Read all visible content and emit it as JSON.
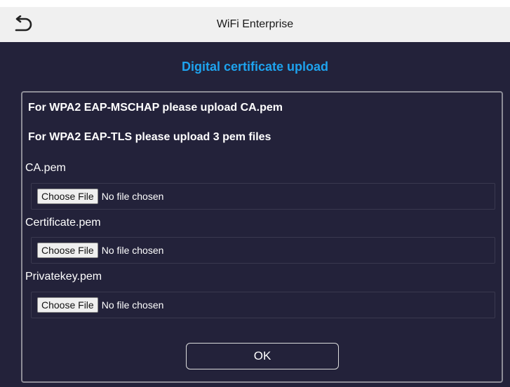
{
  "header": {
    "title": "WiFi Enterprise",
    "back_icon": "back-arrow-icon"
  },
  "main": {
    "subtitle": "Digital certificate upload",
    "notes": [
      "For WPA2 EAP-MSCHAP please upload CA.pem",
      "For WPA2 EAP-TLS please upload 3 pem files"
    ],
    "uploads": [
      {
        "label": "CA.pem",
        "button": "Choose File",
        "status": "No file chosen"
      },
      {
        "label": "Certificate.pem",
        "button": "Choose File",
        "status": "No file chosen"
      },
      {
        "label": "Privatekey.pem",
        "button": "Choose File",
        "status": "No file chosen"
      }
    ],
    "ok_label": "OK"
  },
  "colors": {
    "background": "#23223a",
    "accent": "#1ea3ee",
    "header_bg": "#f0f0f0"
  }
}
